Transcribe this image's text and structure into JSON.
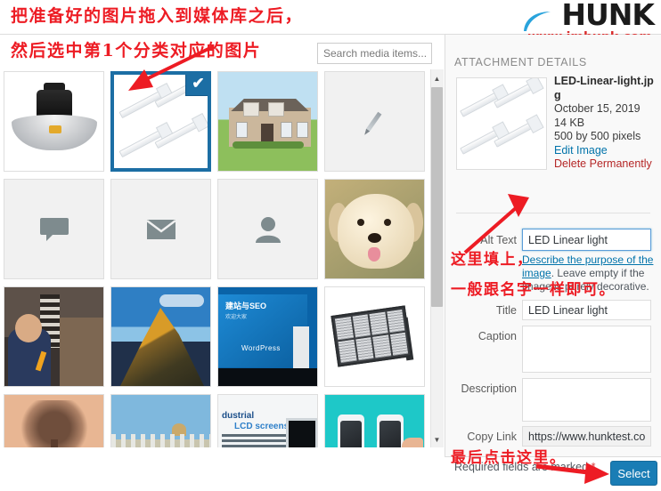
{
  "brand": {
    "logo_text": "HUNK",
    "logo_url": "www.imhunk.com",
    "swoosh_color": "#29a3dc",
    "logo_color": "#1b1b1b",
    "url_color": "#d92b2b"
  },
  "search": {
    "placeholder": "Search media items...",
    "value": ""
  },
  "media_grid": {
    "items": [
      {
        "name": "led-high-bay-light",
        "kind": "image",
        "art": "img-highbay",
        "selected": false,
        "bg": "white"
      },
      {
        "name": "led-linear-light",
        "kind": "image",
        "art": "img-linear",
        "selected": true,
        "bg": "white"
      },
      {
        "name": "house-photo",
        "kind": "image",
        "art": "img-house",
        "selected": false,
        "bg": "white"
      },
      {
        "name": "pencil-placeholder",
        "kind": "placeholder",
        "art": "img-pencil",
        "selected": false,
        "bg": "gray"
      },
      {
        "name": "comment-placeholder",
        "kind": "placeholder",
        "icon": "comment-icon",
        "glyph": "●",
        "selected": false,
        "bg": "gray"
      },
      {
        "name": "envelope-placeholder",
        "kind": "placeholder",
        "icon": "envelope-icon",
        "glyph": "✉",
        "selected": false,
        "bg": "gray"
      },
      {
        "name": "person-placeholder",
        "kind": "placeholder",
        "icon": "person-icon",
        "glyph": "👤",
        "selected": false,
        "bg": "gray"
      },
      {
        "name": "puppy-photo",
        "kind": "image",
        "art": "img-puppy",
        "selected": false,
        "bg": "white"
      },
      {
        "name": "speaker-photo",
        "kind": "image",
        "art": "img-speaker",
        "selected": false,
        "bg": "white"
      },
      {
        "name": "mountain-photo",
        "kind": "image",
        "art": "img-mountain",
        "selected": false,
        "bg": "white"
      },
      {
        "name": "wordpress-seo-talk-photo",
        "kind": "image",
        "art": "img-wpseo",
        "selected": false,
        "bg": "white"
      },
      {
        "name": "led-flood-light",
        "kind": "image",
        "art": "img-flood",
        "selected": false,
        "bg": "white"
      },
      {
        "name": "sunset-tree-photo",
        "kind": "image",
        "art": "img-tree",
        "selected": false,
        "bg": "white"
      },
      {
        "name": "fence-photo",
        "kind": "image",
        "art": "img-fence",
        "selected": false,
        "bg": "white"
      },
      {
        "name": "industrial-lcd-screens-graphic",
        "kind": "image",
        "art": "img-lcd",
        "selected": false,
        "bg": "white"
      },
      {
        "name": "phones-photo",
        "kind": "image",
        "art": "img-phones",
        "selected": false,
        "bg": "white"
      }
    ],
    "selected_check_glyph": "✔",
    "selected_border_color": "#1c6ea4",
    "wpseo_slide_title": "建站与SEO",
    "wpseo_slide_sub": "欢迎大家",
    "wpseo_brand": "WordPress",
    "lcd_line1": "dustrial",
    "lcd_line2": "LCD screens"
  },
  "scrollbar": {
    "up_glyph": "▲",
    "down_glyph": "▼"
  },
  "details": {
    "panel_title": "ATTACHMENT DETAILS",
    "filename": "LED-Linear-light.jpg",
    "date": "October 15, 2019",
    "filesize": "14 KB",
    "dimensions": "500 by 500 pixels",
    "edit_image": "Edit Image",
    "delete_permanently": "Delete Permanently",
    "fields": {
      "alt_text_label": "Alt Text",
      "alt_text_value": "LED Linear light",
      "alt_help_link": "Describe the purpose of the image",
      "alt_help_rest": ". Leave empty if the image is purely decorative.",
      "title_label": "Title",
      "title_value": "LED Linear light",
      "caption_label": "Caption",
      "caption_value": "",
      "description_label": "Description",
      "description_value": "",
      "copy_link_label": "Copy Link",
      "copy_link_value": "https://www.hunktest.com/"
    },
    "required_note": "Required fields are marked",
    "required_star": "*",
    "select_button": "Select",
    "accent_color": "#1a7db5",
    "link_color": "#0073aa",
    "delete_color": "#b52727"
  },
  "annotations": {
    "color": "#ed1c24",
    "line1": "把准备好的图片拖入到媒体库之后，",
    "line2": "然后选中第1个分类对应的图片",
    "line3": "这里填上，",
    "line4": "一般跟名字一样即可。",
    "line5": "最后点击这里。"
  }
}
